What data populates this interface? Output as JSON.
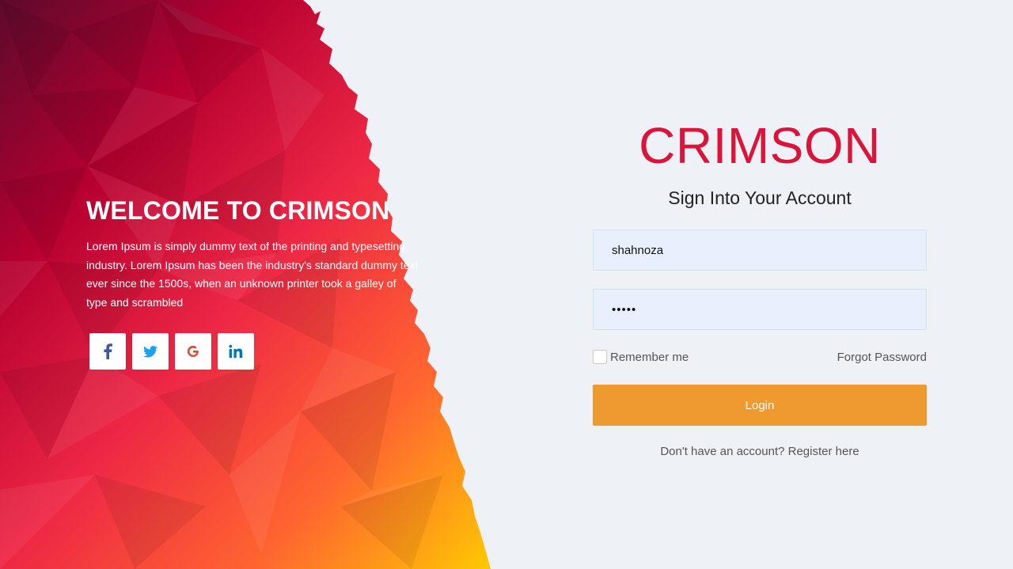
{
  "hero": {
    "title": "WELCOME TO CRIMSON",
    "text": "Lorem Ipsum is simply dummy text of the printing and typesetting industry. Lorem Ipsum has been the industry's standard dummy text ever since the 1500s, when an unknown printer took a galley of type and scrambled"
  },
  "socials": [
    {
      "icon": "facebook-icon",
      "glyph": "f",
      "color": "#3b5998"
    },
    {
      "icon": "twitter-icon",
      "glyph": "",
      "color": "#1da1f2"
    },
    {
      "icon": "google-icon",
      "glyph": "G",
      "color": "#dd4b39"
    },
    {
      "icon": "linkedin-icon",
      "glyph": "in",
      "color": "#0077b5"
    }
  ],
  "login": {
    "brand": "CRIMSON",
    "subtitle": "Sign Into Your Account",
    "username_value": "shahnoza",
    "password_value": "•••••",
    "remember_label": "Remember me",
    "remember_checked": false,
    "forgot_label": "Forgot Password",
    "button_label": "Login",
    "register_label": "Don't have an account? Register here"
  },
  "colors": {
    "brand": "#dc143c",
    "button": "#ef9a2f",
    "page_bg": "#eef1f6",
    "input_bg": "#e8f0fe",
    "gradient": [
      "#6b0930",
      "#c4002f",
      "#f0284a",
      "#ff6a2a",
      "#ffd000"
    ]
  }
}
